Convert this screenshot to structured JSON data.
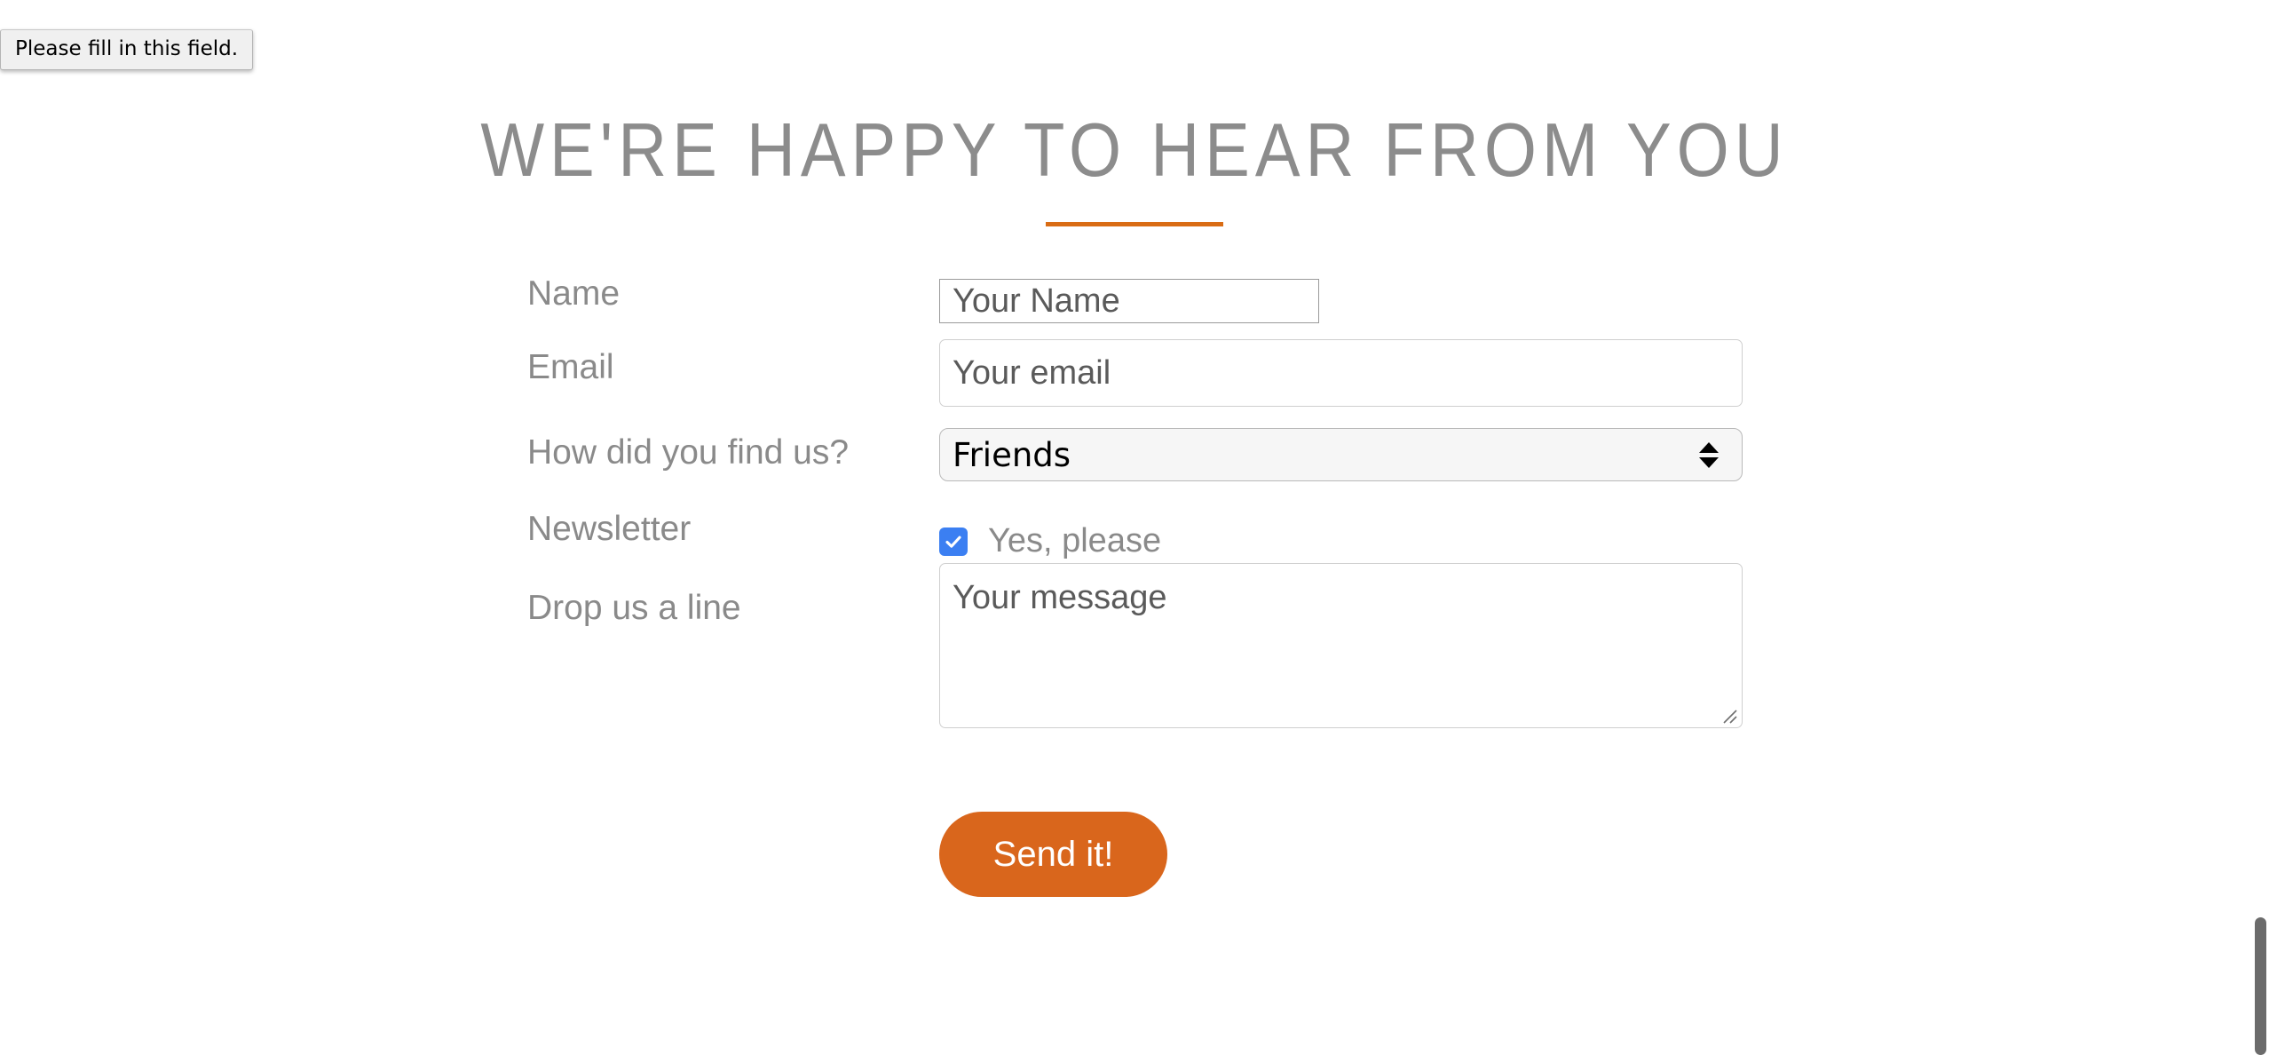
{
  "validation_tooltip": {
    "message": "Please fill in this field.",
    "target_field": "name"
  },
  "header": {
    "title": "WE'RE HAPPY TO HEAR FROM YOU",
    "divider_color": "#d96c14"
  },
  "form": {
    "fields": [
      {
        "label": "Name",
        "type": "text",
        "value": "",
        "placeholder": "Your Name",
        "invalid": true
      },
      {
        "label": "Email",
        "type": "email",
        "value": "",
        "placeholder": "Your email",
        "invalid": false
      },
      {
        "label": "How did you find us?",
        "type": "select",
        "selected": "Friends",
        "options": [
          "Friends"
        ]
      },
      {
        "label": "Newsletter",
        "type": "checkbox",
        "checkbox_label": "Yes, please",
        "checked": true,
        "checkbox_color": "#3b7ff2"
      },
      {
        "label": "Drop us a line",
        "type": "textarea",
        "value": "",
        "placeholder": "Your message"
      }
    ],
    "submit_label": "Send it!",
    "submit_color": "#d9661c"
  },
  "scrollbar": {
    "position": "right",
    "thumb_color": "#6b6b6b"
  }
}
